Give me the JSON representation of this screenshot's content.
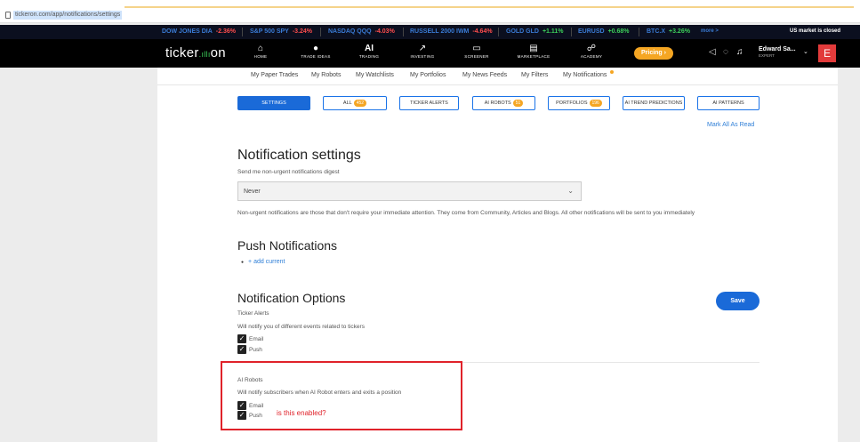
{
  "browser": {
    "url": "tickeron.com/app/notifications/settings"
  },
  "ticker": {
    "items": [
      {
        "name": "DOW JONES DIA",
        "change": "-2.36%",
        "dir": "neg"
      },
      {
        "name": "S&P 500 SPY",
        "change": "-3.24%",
        "dir": "neg"
      },
      {
        "name": "NASDAQ QQQ",
        "change": "-4.03%",
        "dir": "neg"
      },
      {
        "name": "RUSSELL 2000 IWM",
        "change": "-4.64%",
        "dir": "neg"
      },
      {
        "name": "GOLD GLD",
        "change": "+1.11%",
        "dir": "pos"
      },
      {
        "name": "EURUSD",
        "change": "+0.68%",
        "dir": "pos"
      },
      {
        "name": "BTC.X",
        "change": "+3.26%",
        "dir": "pos"
      }
    ],
    "more": "more >",
    "market_status": "US market is closed"
  },
  "nav": {
    "logo": "ticker",
    "logo_suffix": "on",
    "items": [
      {
        "label": "HOME",
        "icon": "home-icon"
      },
      {
        "label": "TRADE IDEAS",
        "icon": "bulb-icon"
      },
      {
        "label": "TRADING",
        "icon": "ai-icon",
        "glyph": "AI"
      },
      {
        "label": "INVESTING",
        "icon": "rocket-icon"
      },
      {
        "label": "SCREENER",
        "icon": "monitor-icon"
      },
      {
        "label": "MARKETPLACE",
        "icon": "store-icon"
      },
      {
        "label": "ACADEMY",
        "icon": "people-icon"
      }
    ],
    "pricing": "Pricing ›",
    "user_name": "Edward Sa...",
    "user_role": "EXPERT",
    "avatar_letter": "E"
  },
  "subnav": {
    "links": [
      "My Paper Trades",
      "My Robots",
      "My Watchlists",
      "My Portfolios",
      "My News Feeds",
      "My Filters",
      "My Notifications"
    ]
  },
  "tabs": [
    {
      "label": "SETTINGS",
      "active": true
    },
    {
      "label": "ALL",
      "badge": "452"
    },
    {
      "label": "TICKER ALERTS"
    },
    {
      "label": "AI ROBOTS",
      "badge": "51"
    },
    {
      "label": "PORTFOLIOS",
      "badge": "196"
    },
    {
      "label": "AI TREND PREDICTIONS"
    },
    {
      "label": "AI PATTERNS"
    }
  ],
  "mark_all": "Mark All As Read",
  "settings": {
    "title": "Notification settings",
    "digest_label": "Send me non-urgent notifications digest",
    "digest_value": "Never",
    "digest_help": "Non-urgent notifications are those that don't require your immediate attention. They come from Community, Articles and Blogs. All other notifications will be sent to you immediately"
  },
  "push": {
    "title": "Push Notifications",
    "add_current": "+ add current"
  },
  "options": {
    "title": "Notification Options",
    "save": "Save",
    "groups": [
      {
        "name": "Ticker Alerts",
        "desc": "Will notify you of different events related to tickers",
        "email": "Email",
        "push": "Push"
      },
      {
        "name": "AI Robots",
        "desc": "Will notify subscribers when AI Robot enters and exits a position",
        "email": "Email",
        "push": "Push"
      }
    ]
  },
  "annotation": {
    "text": "is this enabled?",
    "color": "#e0222a"
  }
}
